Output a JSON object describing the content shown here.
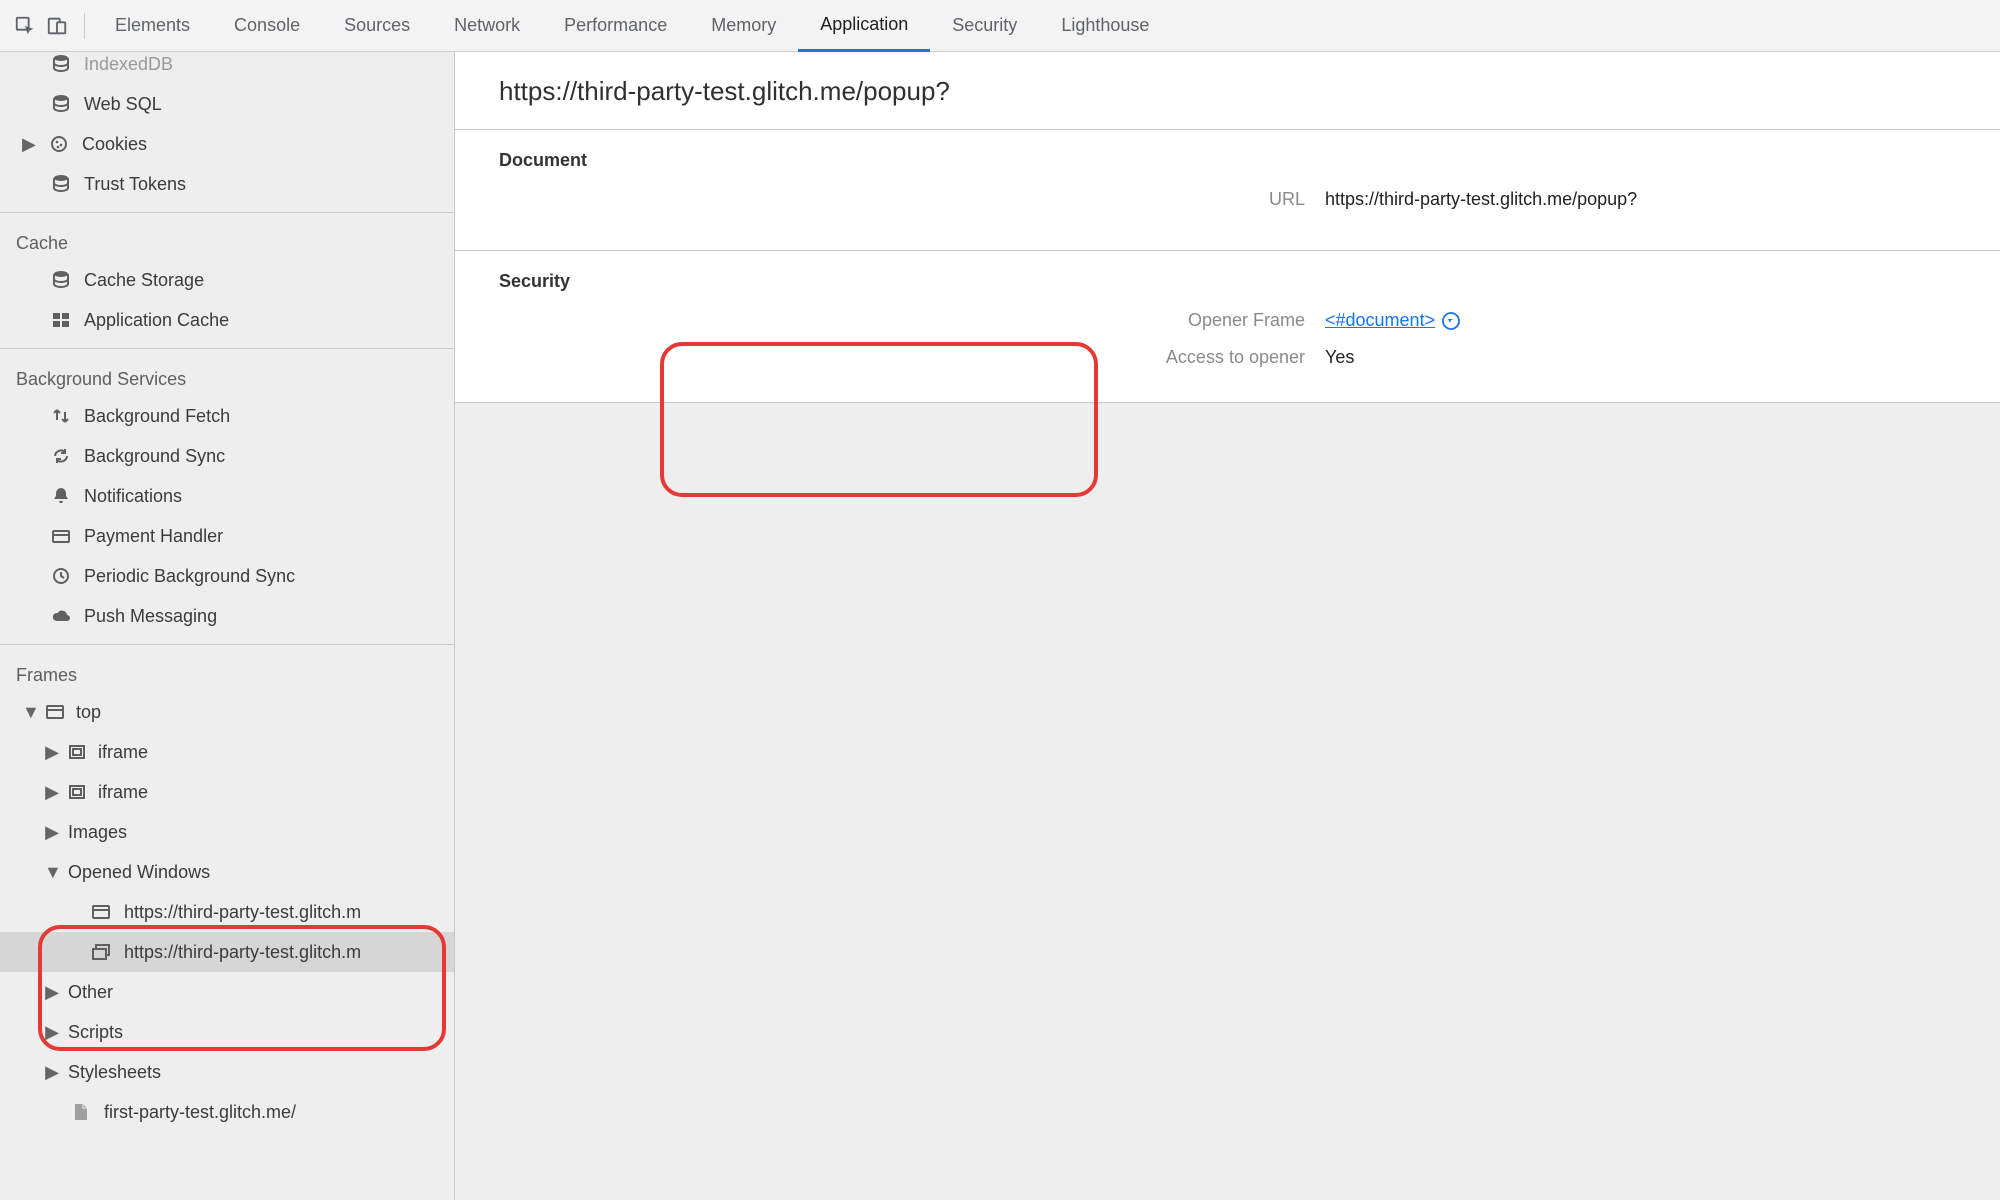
{
  "tabs": {
    "elements": "Elements",
    "console": "Console",
    "sources": "Sources",
    "network": "Network",
    "performance": "Performance",
    "memory": "Memory",
    "application": "Application",
    "security": "Security",
    "lighthouse": "Lighthouse"
  },
  "sidebar": {
    "storage": {
      "indexeddb": "IndexedDB",
      "web_sql": "Web SQL",
      "cookies": "Cookies",
      "trust_tokens": "Trust Tokens"
    },
    "cache": {
      "heading": "Cache",
      "cache_storage": "Cache Storage",
      "application_cache": "Application Cache"
    },
    "background_services": {
      "heading": "Background Services",
      "background_fetch": "Background Fetch",
      "background_sync": "Background Sync",
      "notifications": "Notifications",
      "payment_handler": "Payment Handler",
      "periodic_background_sync": "Periodic Background Sync",
      "push_messaging": "Push Messaging"
    },
    "frames": {
      "heading": "Frames",
      "top": "top",
      "iframe1": "iframe",
      "iframe2": "iframe",
      "images": "Images",
      "opened_windows": "Opened Windows",
      "opened_windows_items": [
        "https://third-party-test.glitch.m",
        "https://third-party-test.glitch.m"
      ],
      "other": "Other",
      "scripts": "Scripts",
      "stylesheets": "Stylesheets",
      "stylesheet_file": "first-party-test.glitch.me/"
    }
  },
  "detail": {
    "title": "https://third-party-test.glitch.me/popup?",
    "document": {
      "heading": "Document",
      "url_label": "URL",
      "url_value": "https://third-party-test.glitch.me/popup?"
    },
    "security": {
      "heading": "Security",
      "opener_frame_label": "Opener Frame",
      "opener_frame_value": "<#document>",
      "access_to_opener_label": "Access to opener",
      "access_to_opener_value": "Yes"
    }
  }
}
